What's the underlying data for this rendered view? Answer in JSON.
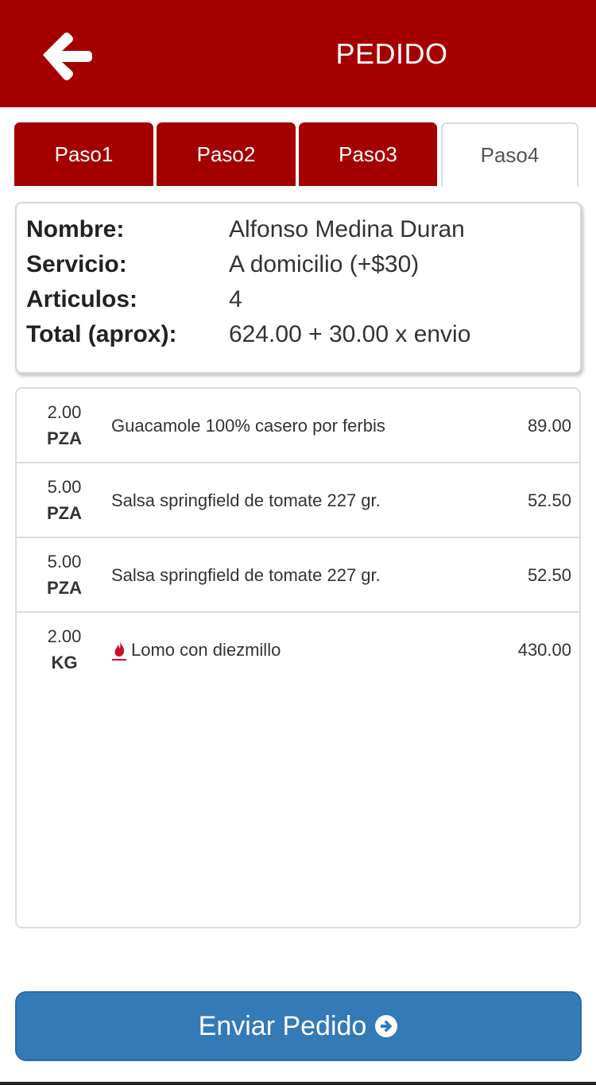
{
  "header": {
    "title": "PEDIDO",
    "back_icon": "arrow-left-icon",
    "background": "#a50000"
  },
  "tabs": [
    {
      "label": "Paso1",
      "active": false
    },
    {
      "label": "Paso2",
      "active": false
    },
    {
      "label": "Paso3",
      "active": false
    },
    {
      "label": "Paso4",
      "active": true
    }
  ],
  "summary": {
    "rows": [
      {
        "key": "Nombre:",
        "value": "Alfonso Medina Duran"
      },
      {
        "key": "Servicio:",
        "value": "A domicilio (+$30)"
      },
      {
        "key": "Articulos:",
        "value": "4"
      },
      {
        "key": "Total (aprox):",
        "value": "624.00 + 30.00 x envio"
      }
    ]
  },
  "items": [
    {
      "qty": "2.00",
      "unit": "PZA",
      "description": "Guacamole 100% casero por ferbis",
      "price": "89.00",
      "icon": ""
    },
    {
      "qty": "5.00",
      "unit": "PZA",
      "description": "Salsa springfield de tomate 227 gr.",
      "price": "52.50",
      "icon": ""
    },
    {
      "qty": "5.00",
      "unit": "PZA",
      "description": "Salsa springfield de tomate 227 gr.",
      "price": "52.50",
      "icon": ""
    },
    {
      "qty": "2.00",
      "unit": "KG",
      "description": "Lomo con diezmillo",
      "price": "430.00",
      "icon": "flame-icon"
    }
  ],
  "send_button": {
    "label": "Enviar Pedido",
    "icon": "arrow-circle-right-icon",
    "color": "#337ab7"
  }
}
